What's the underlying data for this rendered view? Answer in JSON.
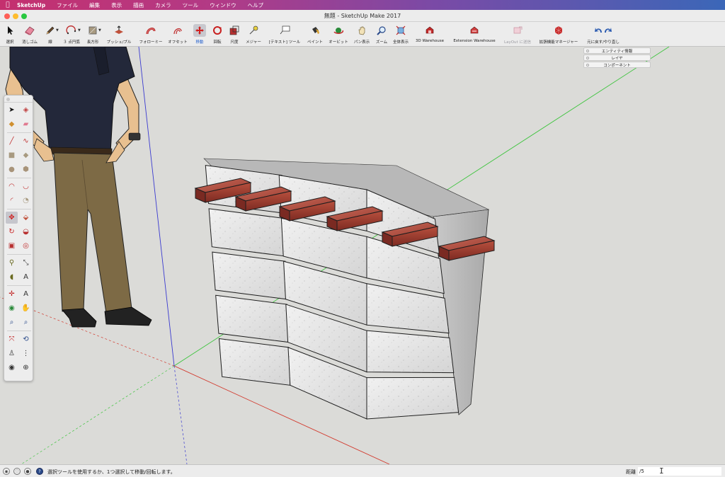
{
  "menubar": {
    "apple_icon": "apple-icon",
    "items": [
      "SketchUp",
      "ファイル",
      "編集",
      "表示",
      "描画",
      "カメラ",
      "ツール",
      "ウィンドウ",
      "ヘルプ"
    ]
  },
  "window": {
    "title": "無題 - SketchUp Make 2017"
  },
  "toolbar": {
    "items": [
      {
        "label": "選択",
        "icon": "select-arrow-icon"
      },
      {
        "label": "消しゴム",
        "icon": "eraser-icon"
      },
      {
        "label": "線",
        "icon": "pencil-icon"
      },
      {
        "label": "３ 点円弧",
        "icon": "arc-icon"
      },
      {
        "label": "長方形",
        "icon": "rectangle-icon"
      },
      {
        "label": "プッシュ/プル",
        "icon": "push-pull-icon"
      },
      {
        "label": "フォローミー",
        "icon": "follow-me-icon"
      },
      {
        "label": "オフセット",
        "icon": "offset-icon"
      },
      {
        "label": "移動",
        "icon": "move-icon"
      },
      {
        "label": "回転",
        "icon": "rotate-icon"
      },
      {
        "label": "尺度",
        "icon": "scale-icon"
      },
      {
        "label": "メジャー",
        "icon": "tape-measure-icon"
      },
      {
        "label": "[テキスト] ツール",
        "icon": "text-tool-icon"
      },
      {
        "label": "ペイント",
        "icon": "paint-bucket-icon"
      },
      {
        "label": "オービット",
        "icon": "orbit-icon"
      },
      {
        "label": "パン表示",
        "icon": "pan-hand-icon"
      },
      {
        "label": "ズーム",
        "icon": "zoom-icon"
      },
      {
        "label": "全体表示",
        "icon": "zoom-extents-icon"
      },
      {
        "label": "3D Warehouse",
        "icon": "warehouse-icon"
      },
      {
        "label": "Extension Warehouse",
        "icon": "extension-warehouse-icon"
      },
      {
        "label": "LayOut に送信",
        "icon": "layout-icon"
      },
      {
        "label": "拡張機能マネージャー",
        "icon": "extension-manager-icon"
      },
      {
        "label": "元に戻す/やり直し",
        "icon": "undo-redo-icon"
      }
    ],
    "active": "移動",
    "disabled": "LayOut に送信"
  },
  "tray": {
    "items": [
      "エンティティ情報",
      "レイヤ",
      "コンポーネント"
    ]
  },
  "colors": {
    "axis_red": "#d23a2e",
    "axis_green": "#3ec43e",
    "axis_blue": "#3a3ad0",
    "brick": "#a8473a",
    "block": "#e6e6e6",
    "active_tool_bg": "#c6c6cc"
  },
  "statusbar": {
    "hint": "選択ツールを使用するか、1つ選択して移動/回転します。",
    "vcb_label": "距離",
    "vcb_value": "/5"
  }
}
